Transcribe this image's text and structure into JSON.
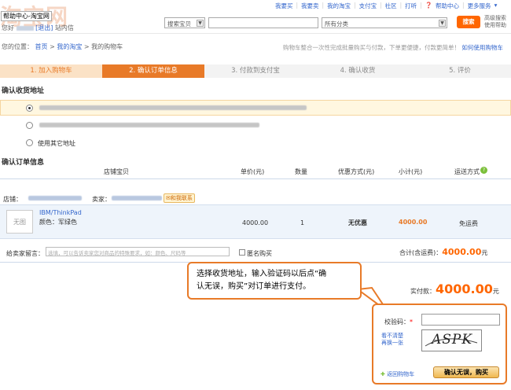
{
  "header": {
    "logo_text": "淘宝网",
    "help_tag": "帮助中心-淘宝网",
    "greeting_prefix": "您好",
    "logout": "[退出]",
    "messages": "站内信",
    "topnav": [
      "我要买",
      "我要卖",
      "我的淘宝",
      "支付宝",
      "社区",
      "打听",
      "帮助中心",
      "更多服务"
    ],
    "search": {
      "scope_label": "搜索宝贝",
      "category_label": "所有分类",
      "button_label": "搜索",
      "extra_line1": "高级搜索",
      "extra_line2": "使用帮助"
    }
  },
  "breadcrumb": {
    "prefix": "您的位置：",
    "home": "首页",
    "sep": ">",
    "my_taobao": "我的淘宝",
    "current": "我的购物车"
  },
  "notice": {
    "text": "购物车整合一次性完成批量购买与付款，下单更便捷，付款更简单！",
    "link": "如何使用购物车"
  },
  "steps": [
    "1. 加入购物车",
    "2. 确认订单信息",
    "3. 付款到支付宝",
    "4. 确认收货",
    "5. 评价"
  ],
  "address": {
    "title": "确认收货地址",
    "other_option": "使用其它地址"
  },
  "order": {
    "title": "确认订单信息",
    "columns": {
      "item": "店铺宝贝",
      "unit_price": "单价(元)",
      "quantity": "数量",
      "discount": "优惠方式(元)",
      "subtotal": "小计(元)",
      "shipping": "运送方式"
    },
    "shop_label": "店铺：",
    "seller_label": "卖家：",
    "contact_label": "和我联系",
    "item": {
      "thumb": "无图",
      "name": "IBM/ThinkPad",
      "color": "颜色：军绿色",
      "unit_price": "4000.00",
      "quantity": "1",
      "discount": "无优惠",
      "subtotal": "4000.00",
      "shipping": "免运费"
    },
    "message_label": "给卖家留言：",
    "message_placeholder": "选填，可以告诉卖家您对商品的特殊要求，如：颜色、尺码等",
    "anonymous_label": "匿名购买",
    "total_label": "合计(含运费)：",
    "total_value": "4000.00",
    "total_unit": "元",
    "paid_label": "实付款：",
    "paid_value": "4000.00",
    "paid_unit": "元"
  },
  "callout": {
    "line1": "选择收货地址，输入验证码以后点“确",
    "line2": "认无误，购买”对订单进行支付。"
  },
  "verify": {
    "code_label": "校验码：",
    "required_mark": "*",
    "unclear_line1": "看不清楚",
    "unclear_line2": "再换一张",
    "captcha_text": "ASPK",
    "back_cart": "返回购物车",
    "confirm_button": "确认无误，购买"
  },
  "colors": {
    "accent": "#e87a28",
    "link": "#3366cc",
    "price": "#ff6600"
  }
}
